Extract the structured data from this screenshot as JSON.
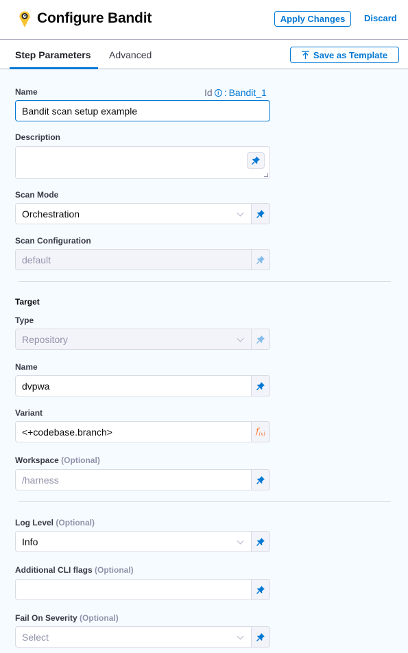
{
  "header": {
    "title": "Configure Bandit",
    "logo_icon": "bandit-logo-icon",
    "apply_label": "Apply Changes",
    "discard_label": "Discard"
  },
  "tabs": {
    "items": [
      {
        "label": "Step Parameters",
        "active": true
      },
      {
        "label": "Advanced",
        "active": false
      }
    ],
    "save_template_label": "Save as Template",
    "save_template_icon": "upload-icon"
  },
  "accent_color": "#0278d5",
  "form": {
    "name": {
      "label": "Name",
      "value": "Bandit scan setup example"
    },
    "id": {
      "label": "Id",
      "separator": ":",
      "value": "Bandit_1"
    },
    "description": {
      "label": "Description",
      "value": ""
    },
    "scan_mode": {
      "label": "Scan Mode",
      "value": "Orchestration"
    },
    "scan_configuration": {
      "label": "Scan Configuration",
      "value": "default"
    },
    "target_section": "Target",
    "type": {
      "label": "Type",
      "value": "Repository"
    },
    "target_name": {
      "label": "Name",
      "value": "dvpwa"
    },
    "variant": {
      "label": "Variant",
      "value": "<+codebase.branch>",
      "icon_label": "f",
      "icon_sub": "(x)"
    },
    "workspace": {
      "label": "Workspace",
      "optional": "(Optional)",
      "placeholder": "/harness"
    },
    "log_level": {
      "label": "Log Level",
      "optional": "(Optional)",
      "value": "Info"
    },
    "cli_flags": {
      "label": "Additional CLI flags",
      "optional": "(Optional)",
      "value": ""
    },
    "fail_on_severity": {
      "label": "Fail On Severity",
      "optional": "(Optional)",
      "placeholder": "Select"
    }
  }
}
